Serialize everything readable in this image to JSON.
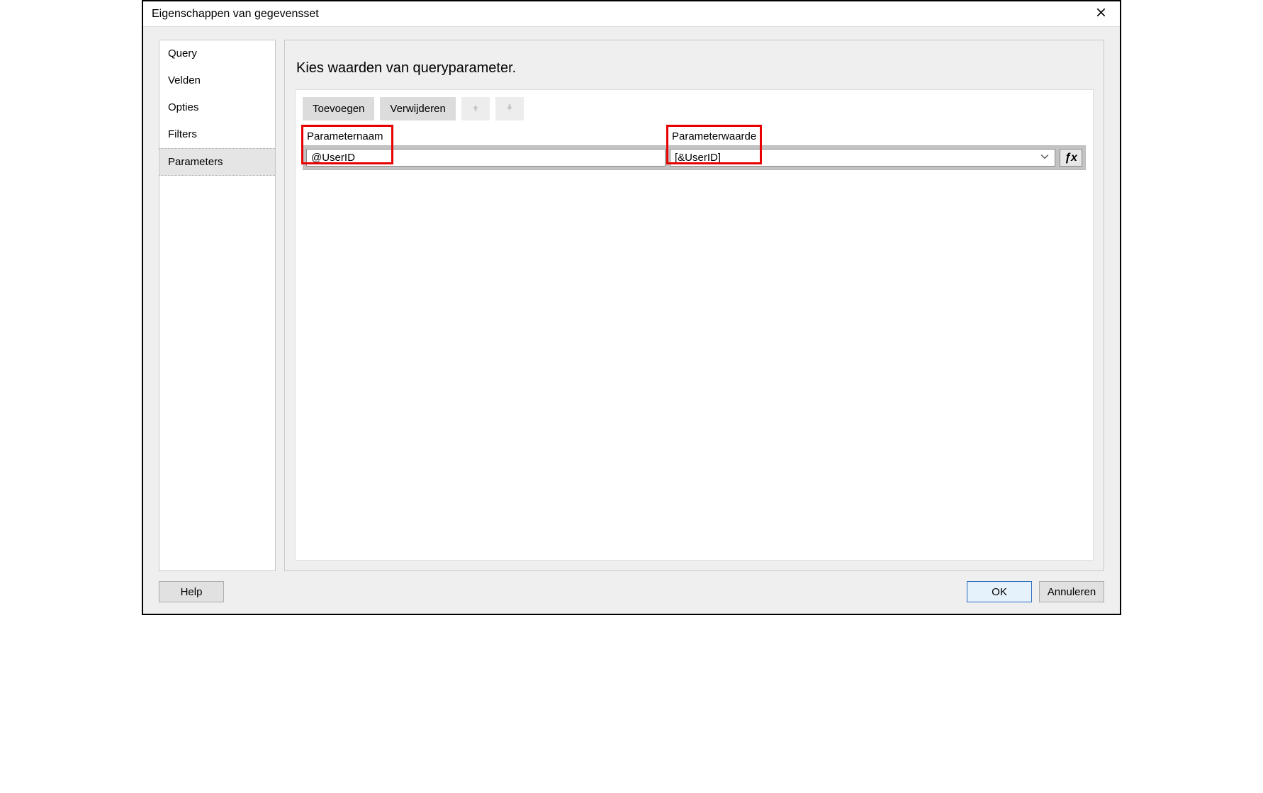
{
  "window": {
    "title": "Eigenschappen van gegevensset"
  },
  "sidebar": {
    "items": [
      {
        "label": "Query"
      },
      {
        "label": "Velden"
      },
      {
        "label": "Opties"
      },
      {
        "label": "Filters"
      },
      {
        "label": "Parameters"
      }
    ],
    "selectedIndex": 4
  },
  "main": {
    "title": "Kies waarden van queryparameter.",
    "toolbar": {
      "add_label": "Toevoegen",
      "remove_label": "Verwijderen"
    },
    "grid": {
      "columns": {
        "name": "Parameternaam",
        "value": "Parameterwaarde"
      },
      "rows": [
        {
          "name": "@UserID",
          "value": "[&UserID]"
        }
      ]
    }
  },
  "footer": {
    "help_label": "Help",
    "ok_label": "OK",
    "cancel_label": "Annuleren"
  }
}
